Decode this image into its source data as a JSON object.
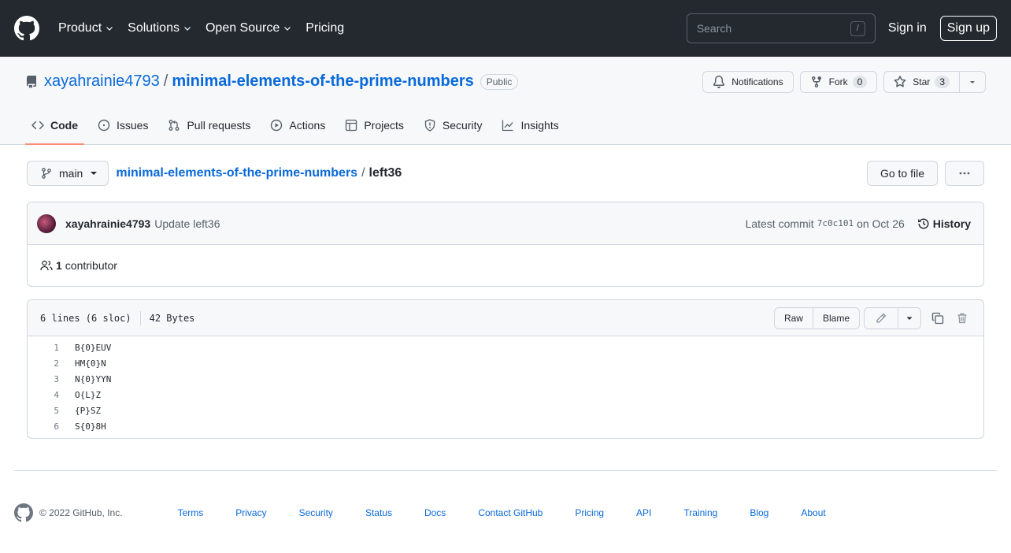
{
  "header": {
    "nav": [
      {
        "label": "Product",
        "dropdown": true
      },
      {
        "label": "Solutions",
        "dropdown": true
      },
      {
        "label": "Open Source",
        "dropdown": true
      },
      {
        "label": "Pricing",
        "dropdown": false
      }
    ],
    "search_placeholder": "Search",
    "search_key": "/",
    "signin": "Sign in",
    "signup": "Sign up"
  },
  "repo": {
    "owner": "xayahrainie4793",
    "separator": "/",
    "name": "minimal-elements-of-the-prime-numbers",
    "visibility": "Public",
    "notifications": "Notifications",
    "fork_label": "Fork",
    "fork_count": "0",
    "star_label": "Star",
    "star_count": "3"
  },
  "tabs": [
    {
      "label": "Code",
      "icon": "code-icon",
      "active": true
    },
    {
      "label": "Issues",
      "icon": "issue-icon",
      "active": false
    },
    {
      "label": "Pull requests",
      "icon": "pull-request-icon",
      "active": false
    },
    {
      "label": "Actions",
      "icon": "play-icon",
      "active": false
    },
    {
      "label": "Projects",
      "icon": "table-icon",
      "active": false
    },
    {
      "label": "Security",
      "icon": "shield-icon",
      "active": false
    },
    {
      "label": "Insights",
      "icon": "graph-icon",
      "active": false
    }
  ],
  "path": {
    "branch": "main",
    "repo": "minimal-elements-of-the-prime-numbers",
    "separator": "/",
    "file": "left36",
    "goto": "Go to file"
  },
  "commit": {
    "author": "xayahrainie4793",
    "message": "Update left36",
    "latest_prefix": "Latest commit",
    "sha": "7c0c101",
    "date": "on Oct 26",
    "history": "History",
    "contributors_count": "1",
    "contributors_label": "contributor"
  },
  "file": {
    "lines_info": "6 lines (6 sloc)",
    "size": "42 Bytes",
    "raw": "Raw",
    "blame": "Blame",
    "lines": [
      {
        "n": "1",
        "text": "B{0}EUV"
      },
      {
        "n": "2",
        "text": "HM{0}N"
      },
      {
        "n": "3",
        "text": "N{0}YYN"
      },
      {
        "n": "4",
        "text": "O{L}Z"
      },
      {
        "n": "5",
        "text": "{P}SZ"
      },
      {
        "n": "6",
        "text": "S{0}8H"
      }
    ]
  },
  "footer": {
    "copyright": "© 2022 GitHub, Inc.",
    "links": [
      "Terms",
      "Privacy",
      "Security",
      "Status",
      "Docs",
      "Contact GitHub",
      "Pricing",
      "API",
      "Training",
      "Blog",
      "About"
    ]
  },
  "colors": {
    "header_bg": "#24292f",
    "link": "#0969da",
    "active_tab_underline": "#fd8c73"
  }
}
